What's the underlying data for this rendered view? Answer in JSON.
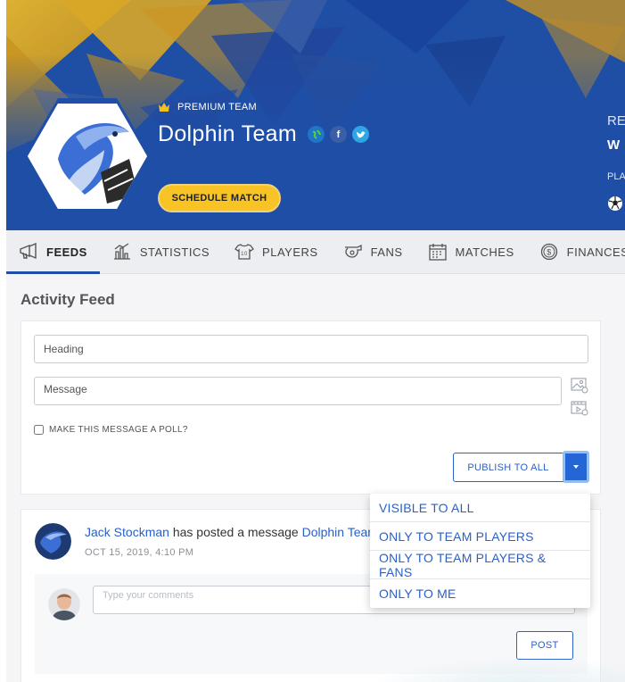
{
  "header": {
    "premium_label": "PREMIUM TEAM",
    "team_name": "Dolphin Team",
    "schedule_button": "SCHEDULE MATCH",
    "side_label_1": "RE",
    "side_value_1": "W",
    "side_label_2": "PLA",
    "social": {
      "globe": "globe-icon",
      "facebook": "f",
      "twitter": "twitter-icon"
    }
  },
  "tabs": [
    {
      "label": "FEEDS",
      "icon": "megaphone-icon",
      "active": true
    },
    {
      "label": "STATISTICS",
      "icon": "bar-chart-icon",
      "active": false
    },
    {
      "label": "PLAYERS",
      "icon": "jersey-icon",
      "active": false
    },
    {
      "label": "FANS",
      "icon": "whistle-icon",
      "active": false
    },
    {
      "label": "MATCHES",
      "icon": "calendar-icon",
      "active": false
    },
    {
      "label": "FINANCES",
      "icon": "coin-icon",
      "active": false
    }
  ],
  "feed": {
    "title": "Activity Feed",
    "heading_placeholder": "Heading",
    "message_placeholder": "Message",
    "poll_label": "MAKE THIS MESSAGE A POLL?",
    "publish_button": "PUBLISH TO ALL"
  },
  "visibility_menu": [
    "VISIBLE TO ALL",
    "ONLY TO TEAM PLAYERS",
    "ONLY TO TEAM PLAYERS & FANS",
    "ONLY TO ME"
  ],
  "post": {
    "author": "Jack Stockman",
    "action": " has posted a message ",
    "team": "Dolphin Team",
    "date": "OCT 15, 2019, 4:10 PM",
    "comment_placeholder": "Type your comments",
    "post_button": "POST"
  },
  "colors": {
    "brand_blue": "#1d4ea8",
    "accent_yellow": "#f7c325",
    "link_blue": "#2a61c8"
  }
}
